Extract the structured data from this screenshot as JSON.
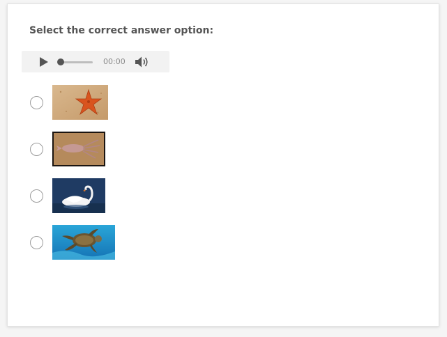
{
  "question": {
    "prompt": "Select the correct answer option:"
  },
  "audio_player": {
    "current_time": "00:00",
    "progress": 0,
    "play_icon": "play-icon",
    "volume_icon": "volume-icon"
  },
  "options": [
    {
      "image": "starfish",
      "selected": false
    },
    {
      "image": "squid",
      "selected": false
    },
    {
      "image": "swan",
      "selected": false
    },
    {
      "image": "sea-turtle",
      "selected": false
    }
  ],
  "colors": {
    "text": "#555555",
    "radio_border": "#9b9b9b",
    "player_bg": "#f2f2f2"
  }
}
